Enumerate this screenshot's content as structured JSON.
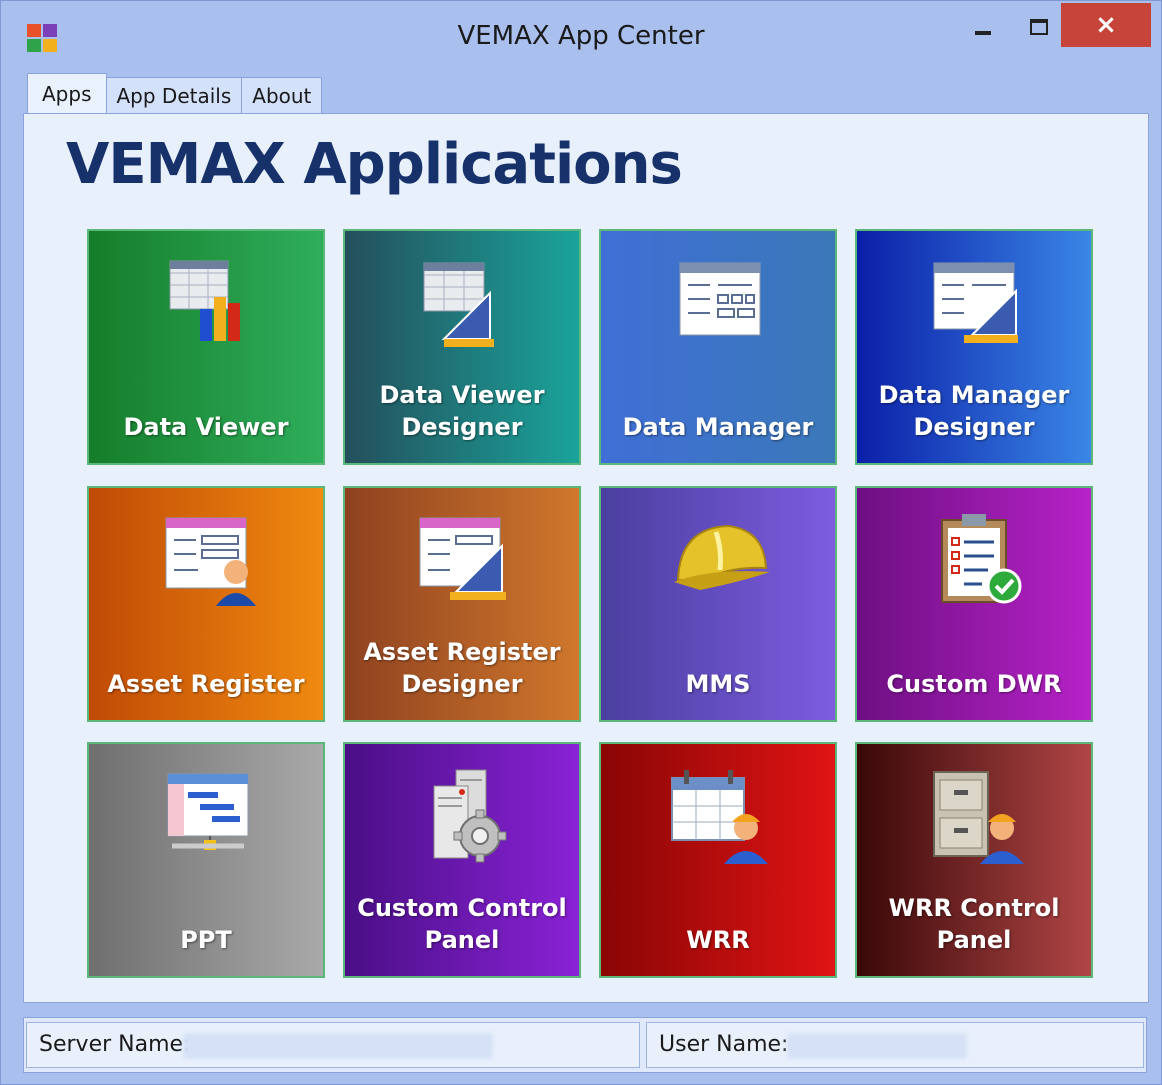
{
  "window": {
    "title": "VEMAX App Center",
    "icon": "app-grid-icon",
    "close_label": "×"
  },
  "tabs": [
    {
      "label": "Apps",
      "active": true
    },
    {
      "label": "App Details",
      "active": false
    },
    {
      "label": "About",
      "active": false
    }
  ],
  "heading": "VEMAX Applications",
  "tiles": [
    {
      "label": "Data Viewer",
      "icon": "spreadsheet-chart-icon",
      "colors": [
        "#157d2a",
        "#2fae5c"
      ]
    },
    {
      "label": "Data Viewer\nDesigner",
      "icon": "spreadsheet-ruler-icon",
      "colors": [
        "#244f5c",
        "#1aa39a"
      ]
    },
    {
      "label": "Data Manager",
      "icon": "form-table-icon",
      "colors": [
        "#3f6fd6",
        "#3b78b8"
      ]
    },
    {
      "label": "Data Manager\nDesigner",
      "icon": "form-ruler-icon",
      "colors": [
        "#0b1fa8",
        "#3a86e6"
      ]
    },
    {
      "label": "Asset Register",
      "icon": "form-user-icon",
      "colors": [
        "#c04a05",
        "#f08a10"
      ]
    },
    {
      "label": "Asset Register\nDesigner",
      "icon": "form-triangle-ruler-icon",
      "colors": [
        "#8f4220",
        "#d0772c"
      ]
    },
    {
      "label": "MMS",
      "icon": "hard-hat-icon",
      "colors": [
        "#4a3f9e",
        "#7d5ce0"
      ]
    },
    {
      "label": "Custom DWR",
      "icon": "clipboard-check-icon",
      "colors": [
        "#6e0f82",
        "#b722c8"
      ]
    },
    {
      "label": "PPT",
      "icon": "gantt-network-icon",
      "colors": [
        "#6f6f6f",
        "#a9a9a9"
      ]
    },
    {
      "label": "Custom Control\nPanel",
      "icon": "server-gear-icon",
      "colors": [
        "#4a0f86",
        "#8a22d6"
      ]
    },
    {
      "label": "WRR",
      "icon": "calendar-worker-icon",
      "colors": [
        "#8a0505",
        "#e01414"
      ]
    },
    {
      "label": "WRR Control\nPanel",
      "icon": "cabinet-worker-icon",
      "colors": [
        "#3a0808",
        "#b04545"
      ]
    }
  ],
  "status": {
    "server_label": "Server Name:",
    "user_label": "User Name:"
  }
}
